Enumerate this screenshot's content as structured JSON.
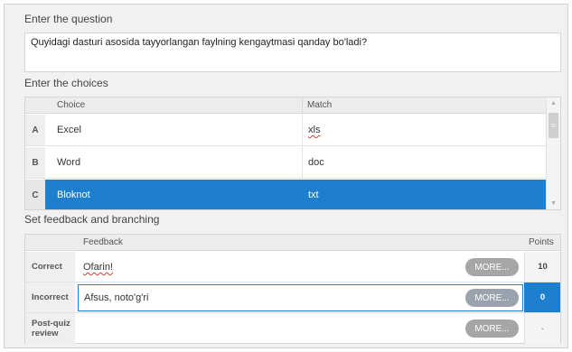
{
  "question": {
    "title": "Enter the question",
    "text": "Quyidagi dasturi asosida tayyorlangan faylning kengaytmasi qanday bo'ladi?"
  },
  "choices": {
    "title": "Enter the choices",
    "columns": {
      "choice": "Choice",
      "match": "Match"
    },
    "rows": [
      {
        "letter": "A",
        "choice": "Excel",
        "match": "xls"
      },
      {
        "letter": "B",
        "choice": "Word",
        "match": "doc"
      },
      {
        "letter": "C",
        "choice": "Bloknot",
        "match": "txt"
      }
    ],
    "selected_row": "C",
    "scroll_up_glyph": "▲",
    "scroll_down_glyph": "▼",
    "scroll_thumb_glyph": "≡"
  },
  "feedback": {
    "title": "Set feedback and branching",
    "columns": {
      "feedback": "Feedback",
      "points": "Points"
    },
    "rows": [
      {
        "label": "Correct",
        "text": "Ofarin!",
        "more": "MORE...",
        "points": "10"
      },
      {
        "label": "Incorrect",
        "text": "Afsus, noto'g'ri",
        "more": "MORE...",
        "points": "0"
      },
      {
        "label": "Post-quiz review",
        "text": "",
        "more": "MORE...",
        "points": "-"
      }
    ],
    "active_row": "Incorrect"
  },
  "colors": {
    "accent": "#1e7fcf",
    "panel_bg": "#f1f1f1",
    "more_button": "#a6a6a6"
  }
}
